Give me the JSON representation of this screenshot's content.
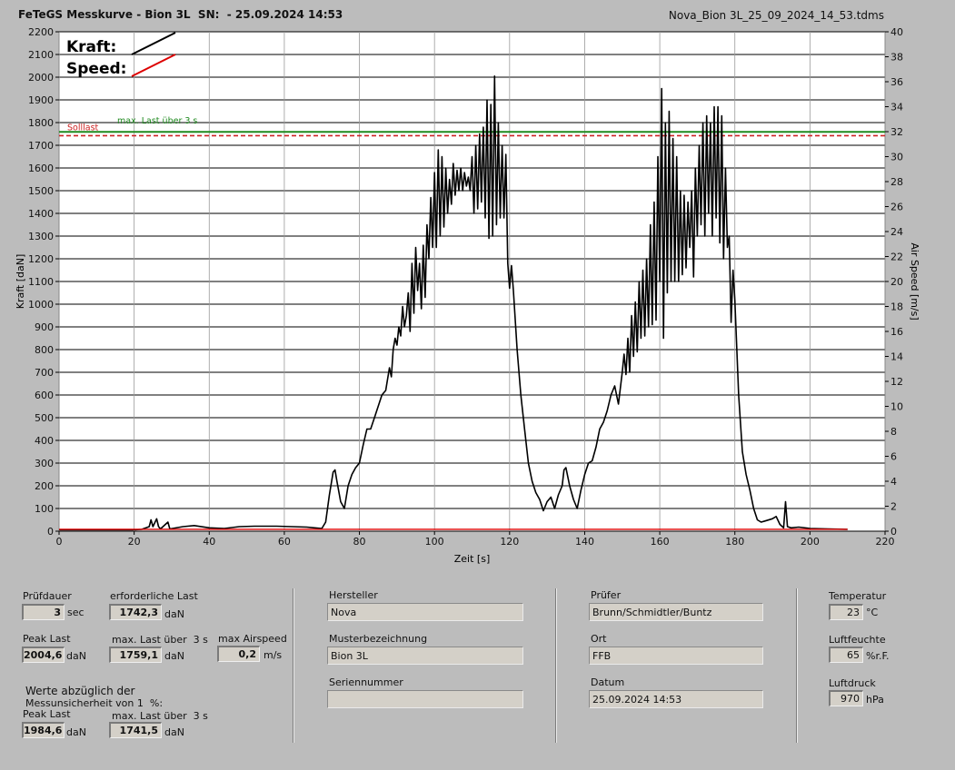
{
  "header": {
    "title": "FeTeGS Messkurve - Bion 3L  SN:  - 25.09.2024 14:53",
    "filename": "Nova_Bion 3L_25_09_2024_14_53.tdms"
  },
  "chart_data": {
    "type": "line",
    "xlabel": "Zeit [s]",
    "ylabel": "Kraft [daN]",
    "y2label": "Air Speed [m/s]",
    "xlim": [
      0,
      220
    ],
    "ylim": [
      0,
      2200
    ],
    "y2lim": [
      0,
      40
    ],
    "x_ticks": [
      0,
      20,
      40,
      60,
      80,
      100,
      120,
      140,
      160,
      180,
      200,
      220
    ],
    "y_ticks": [
      0,
      100,
      200,
      300,
      400,
      500,
      600,
      700,
      800,
      900,
      1000,
      1100,
      1200,
      1300,
      1400,
      1500,
      1600,
      1700,
      1800,
      1900,
      2000,
      2100,
      2200
    ],
    "y2_ticks": [
      0,
      2,
      4,
      6,
      8,
      10,
      12,
      14,
      16,
      18,
      20,
      22,
      24,
      26,
      28,
      30,
      32,
      34,
      36,
      38,
      40
    ],
    "grid": true,
    "legend": [
      {
        "label": "Kraft:",
        "color": "#000000"
      },
      {
        "label": "Speed:",
        "color": "#dd0000"
      }
    ],
    "annotations": {
      "sollast_label": "Solllast",
      "maxlast_label": "max. Last über  3 s",
      "sollast_value": 1742.3,
      "maxlast_value": 1759.1,
      "sollast_color": "#cc2222",
      "maxlast_color": "#1f8a1f"
    },
    "series": [
      {
        "name": "Kraft",
        "color": "#000000",
        "points": [
          [
            0,
            6
          ],
          [
            20,
            6
          ],
          [
            22,
            8
          ],
          [
            24,
            20
          ],
          [
            24.5,
            50
          ],
          [
            25,
            20
          ],
          [
            26,
            55
          ],
          [
            26.5,
            20
          ],
          [
            27,
            10
          ],
          [
            29,
            40
          ],
          [
            29.5,
            10
          ],
          [
            33,
            20
          ],
          [
            36,
            25
          ],
          [
            40,
            15
          ],
          [
            44,
            12
          ],
          [
            48,
            20
          ],
          [
            52,
            22
          ],
          [
            58,
            22
          ],
          [
            62,
            20
          ],
          [
            66,
            18
          ],
          [
            68,
            15
          ],
          [
            70,
            12
          ],
          [
            71,
            40
          ],
          [
            72,
            160
          ],
          [
            73,
            260
          ],
          [
            73.5,
            270
          ],
          [
            74,
            220
          ],
          [
            75,
            130
          ],
          [
            76,
            100
          ],
          [
            77,
            200
          ],
          [
            78,
            250
          ],
          [
            79,
            280
          ],
          [
            80,
            300
          ],
          [
            81,
            380
          ],
          [
            82,
            450
          ],
          [
            83,
            450
          ],
          [
            84,
            500
          ],
          [
            85,
            550
          ],
          [
            86,
            600
          ],
          [
            87,
            620
          ],
          [
            88,
            720
          ],
          [
            88.5,
            680
          ],
          [
            89,
            800
          ],
          [
            89.5,
            850
          ],
          [
            90,
            820
          ],
          [
            90.5,
            900
          ],
          [
            91,
            860
          ],
          [
            91.5,
            990
          ],
          [
            92,
            900
          ],
          [
            92.5,
            950
          ],
          [
            93,
            1050
          ],
          [
            93.5,
            880
          ],
          [
            94,
            1180
          ],
          [
            94.5,
            960
          ],
          [
            95,
            1250
          ],
          [
            95.5,
            1060
          ],
          [
            96,
            1180
          ],
          [
            96.5,
            980
          ],
          [
            97,
            1260
          ],
          [
            97.5,
            1030
          ],
          [
            98,
            1350
          ],
          [
            98.5,
            1200
          ],
          [
            99,
            1470
          ],
          [
            99.5,
            1250
          ],
          [
            100,
            1580
          ],
          [
            100.5,
            1250
          ],
          [
            101,
            1680
          ],
          [
            101.5,
            1300
          ],
          [
            102,
            1650
          ],
          [
            102.5,
            1340
          ],
          [
            103,
            1600
          ],
          [
            103.5,
            1400
          ],
          [
            104,
            1550
          ],
          [
            104.5,
            1440
          ],
          [
            105,
            1620
          ],
          [
            105.5,
            1480
          ],
          [
            106,
            1590
          ],
          [
            106.5,
            1500
          ],
          [
            107,
            1600
          ],
          [
            107.5,
            1500
          ],
          [
            108,
            1580
          ],
          [
            108.5,
            1520
          ],
          [
            109,
            1560
          ],
          [
            109.5,
            1500
          ],
          [
            110,
            1650
          ],
          [
            110.5,
            1400
          ],
          [
            111,
            1700
          ],
          [
            111.5,
            1420
          ],
          [
            112,
            1750
          ],
          [
            112.5,
            1450
          ],
          [
            113,
            1780
          ],
          [
            113.5,
            1380
          ],
          [
            114,
            1900
          ],
          [
            114.5,
            1290
          ],
          [
            115,
            1880
          ],
          [
            115.5,
            1300
          ],
          [
            116,
            2005
          ],
          [
            116.5,
            1350
          ],
          [
            117,
            1800
          ],
          [
            117.5,
            1380
          ],
          [
            118,
            1700
          ],
          [
            118.5,
            1380
          ],
          [
            119,
            1660
          ],
          [
            119.5,
            1180
          ],
          [
            120,
            1070
          ],
          [
            120.5,
            1170
          ],
          [
            121,
            1060
          ],
          [
            122,
            800
          ],
          [
            123,
            600
          ],
          [
            124,
            450
          ],
          [
            125,
            300
          ],
          [
            126,
            220
          ],
          [
            127,
            170
          ],
          [
            128,
            140
          ],
          [
            129,
            90
          ],
          [
            130,
            130
          ],
          [
            131,
            150
          ],
          [
            132,
            100
          ],
          [
            133,
            160
          ],
          [
            134,
            200
          ],
          [
            134.5,
            270
          ],
          [
            135,
            280
          ],
          [
            136,
            200
          ],
          [
            137,
            140
          ],
          [
            138,
            100
          ],
          [
            139,
            180
          ],
          [
            140,
            250
          ],
          [
            141,
            300
          ],
          [
            142,
            310
          ],
          [
            143,
            370
          ],
          [
            144,
            450
          ],
          [
            145,
            480
          ],
          [
            146,
            530
          ],
          [
            147,
            600
          ],
          [
            148,
            640
          ],
          [
            149,
            560
          ],
          [
            150,
            700
          ],
          [
            150.5,
            780
          ],
          [
            151,
            690
          ],
          [
            151.5,
            850
          ],
          [
            152,
            700
          ],
          [
            152.5,
            950
          ],
          [
            153,
            770
          ],
          [
            153.5,
            1010
          ],
          [
            154,
            790
          ],
          [
            154.5,
            1100
          ],
          [
            155,
            850
          ],
          [
            155.5,
            1150
          ],
          [
            156,
            860
          ],
          [
            156.5,
            1200
          ],
          [
            157,
            900
          ],
          [
            157.5,
            1350
          ],
          [
            158,
            910
          ],
          [
            158.5,
            1450
          ],
          [
            159,
            930
          ],
          [
            159.5,
            1650
          ],
          [
            160,
            1100
          ],
          [
            160.5,
            1950
          ],
          [
            161,
            850
          ],
          [
            161.5,
            1800
          ],
          [
            162,
            1050
          ],
          [
            162.5,
            1850
          ],
          [
            163,
            1100
          ],
          [
            163.5,
            1730
          ],
          [
            164,
            1100
          ],
          [
            164.5,
            1650
          ],
          [
            165,
            1100
          ],
          [
            165.5,
            1500
          ],
          [
            166,
            1130
          ],
          [
            166.5,
            1480
          ],
          [
            167,
            1160
          ],
          [
            167.5,
            1450
          ],
          [
            168,
            1250
          ],
          [
            168.5,
            1500
          ],
          [
            169,
            1120
          ],
          [
            169.5,
            1600
          ],
          [
            170,
            1300
          ],
          [
            170.5,
            1700
          ],
          [
            171,
            1350
          ],
          [
            171.5,
            1800
          ],
          [
            172,
            1300
          ],
          [
            172.5,
            1830
          ],
          [
            173,
            1400
          ],
          [
            173.5,
            1800
          ],
          [
            174,
            1300
          ],
          [
            174.5,
            1870
          ],
          [
            175,
            1380
          ],
          [
            175.5,
            1870
          ],
          [
            176,
            1270
          ],
          [
            176.5,
            1830
          ],
          [
            177,
            1200
          ],
          [
            177.5,
            1600
          ],
          [
            178,
            1250
          ],
          [
            178.5,
            1300
          ],
          [
            179,
            920
          ],
          [
            179.5,
            1150
          ],
          [
            180,
            1020
          ],
          [
            181,
            600
          ],
          [
            182,
            350
          ],
          [
            183,
            250
          ],
          [
            184,
            180
          ],
          [
            185,
            100
          ],
          [
            186,
            50
          ],
          [
            187,
            40
          ],
          [
            188,
            45
          ],
          [
            190,
            55
          ],
          [
            191,
            65
          ],
          [
            192,
            30
          ],
          [
            193,
            15
          ],
          [
            193.5,
            130
          ],
          [
            194,
            20
          ],
          [
            195,
            15
          ],
          [
            197,
            18
          ],
          [
            200,
            12
          ],
          [
            205,
            10
          ],
          [
            210,
            8
          ]
        ]
      },
      {
        "name": "Speed",
        "color": "#dd0000",
        "points": [
          [
            0,
            0.15
          ],
          [
            210,
            0.15
          ]
        ]
      }
    ]
  },
  "panel": {
    "pruefdauer_label": "Prüfdauer",
    "pruefdauer_value": "3",
    "pruefdauer_unit": "sec",
    "erforderliche_last_label": "erforderliche Last",
    "erforderliche_last_value": "1742,3",
    "erforderliche_last_unit": "daN",
    "peak_last_label": "Peak Last",
    "peak_last_value": "2004,6",
    "peak_last_unit": "daN",
    "max_last_label": "max. Last über  3 s",
    "max_last_value": "1759,1",
    "max_last_unit": "daN",
    "max_airspeed_label": "max Airspeed",
    "max_airspeed_value": "0,2",
    "max_airspeed_unit": "m/s",
    "werte_line1": "Werte abzüglich der",
    "werte_line2": "Messunsicherheit von 1  %:",
    "peak_last2_label": "Peak Last",
    "peak_last2_value": "1984,6",
    "peak_last2_unit": "daN",
    "max_last2_label": "max. Last über  3 s",
    "max_last2_value": "1741,5",
    "max_last2_unit": "daN",
    "hersteller_label": "Hersteller",
    "hersteller_value": "Nova",
    "muster_label": "Musterbezeichnung",
    "muster_value": "Bion 3L",
    "serien_label": "Seriennummer",
    "serien_value": "",
    "pruefer_label": "Prüfer",
    "pruefer_value": "Brunn/Schmidtler/Buntz",
    "ort_label": "Ort",
    "ort_value": "FFB",
    "datum_label": "Datum",
    "datum_value": "25.09.2024 14:53",
    "temperatur_label": "Temperatur",
    "temperatur_value": "23",
    "temperatur_unit": "°C",
    "luftfeuchte_label": "Luftfeuchte",
    "luftfeuchte_value": "65",
    "luftfeuchte_unit": "%r.F.",
    "luftdruck_label": "Luftdruck",
    "luftdruck_value": "970",
    "luftdruck_unit": "hPa"
  }
}
